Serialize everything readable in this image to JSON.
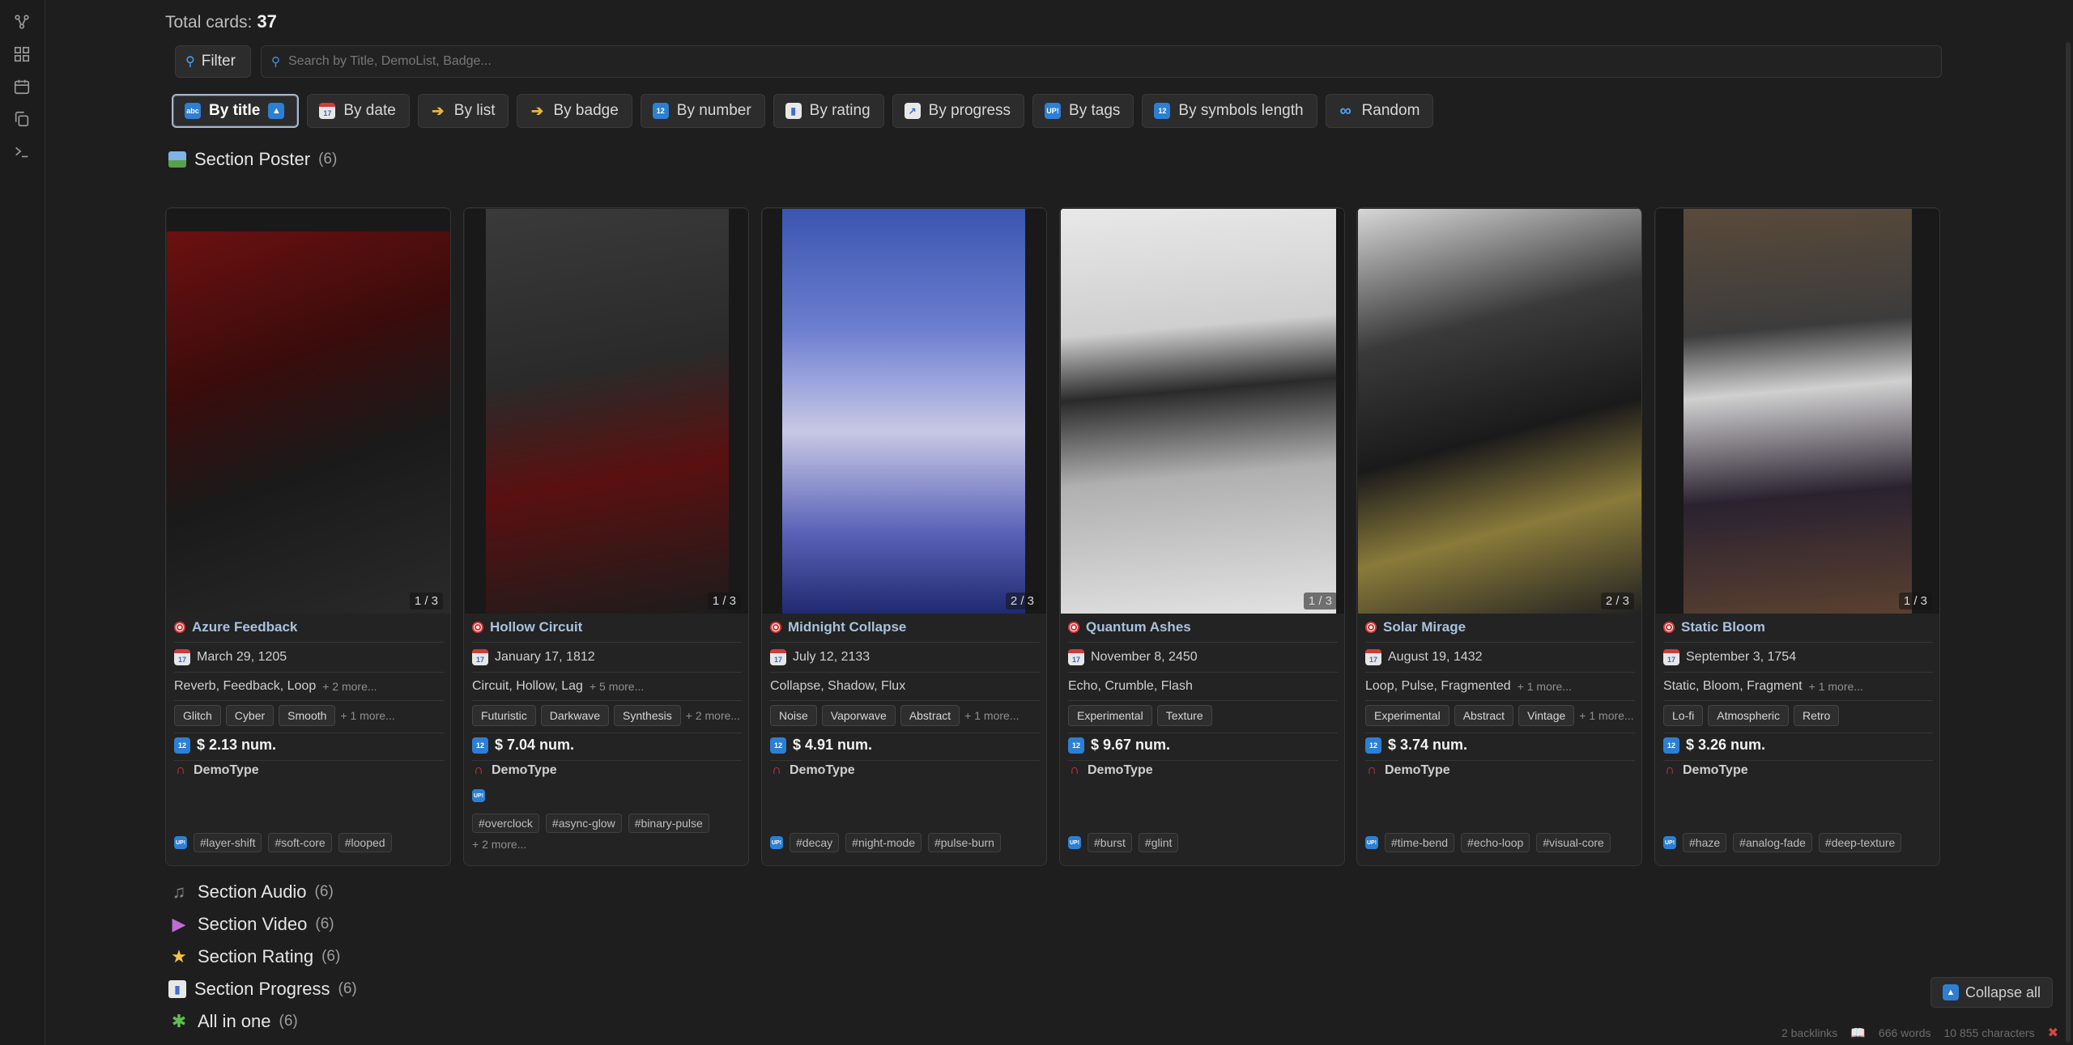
{
  "header": {
    "total_label": "Total cards:",
    "total_value": "37"
  },
  "filter": {
    "button_label": "Filter",
    "search_placeholder": "Search by Title, DemoList, Badge..."
  },
  "sort_buttons": [
    {
      "label": "By title",
      "icon": "abc-icon",
      "active": true
    },
    {
      "label": "By date",
      "icon": "calendar-icon"
    },
    {
      "label": "By list",
      "icon": "tag-icon"
    },
    {
      "label": "By badge",
      "icon": "tag-icon"
    },
    {
      "label": "By number",
      "icon": "numbers-icon"
    },
    {
      "label": "By rating",
      "icon": "bar-chart-icon"
    },
    {
      "label": "By progress",
      "icon": "line-chart-icon"
    },
    {
      "label": "By tags",
      "icon": "up-icon"
    },
    {
      "label": "By symbols length",
      "icon": "numbers-icon"
    },
    {
      "label": "Random",
      "icon": "infinity-icon"
    }
  ],
  "section_poster": {
    "label": "Section Poster",
    "count": "(6)"
  },
  "cards": [
    {
      "title": "Azure Feedback",
      "date": "March 29, 1205",
      "list": "Reverb, Feedback, Loop",
      "list_more": "+ 2 more...",
      "pills": [
        "Glitch",
        "Cyber",
        "Smooth"
      ],
      "pills_more": "+ 1 more...",
      "price": "$ 2.13 num.",
      "badge": "DemoType",
      "pager": "1 / 3",
      "tags": [
        "#layer-shift",
        "#soft-core",
        "#looped"
      ],
      "tags_more": ""
    },
    {
      "title": "Hollow Circuit",
      "date": "January 17, 1812",
      "list": "Circuit, Hollow, Lag",
      "list_more": "+ 5 more...",
      "pills": [
        "Futuristic",
        "Darkwave",
        "Synthesis"
      ],
      "pills_more": "+ 2 more...",
      "price": "$ 7.04 num.",
      "badge": "DemoType",
      "pager": "1 / 3",
      "tags": [
        "#overclock",
        "#async-glow",
        "#binary-pulse"
      ],
      "tags_more": "+ 2 more..."
    },
    {
      "title": "Midnight Collapse",
      "date": "July 12, 2133",
      "list": "Collapse, Shadow, Flux",
      "list_more": "",
      "pills": [
        "Noise",
        "Vaporwave",
        "Abstract"
      ],
      "pills_more": "+ 1 more...",
      "price": "$ 4.91 num.",
      "badge": "DemoType",
      "pager": "2 / 3",
      "tags": [
        "#decay",
        "#night-mode",
        "#pulse-burn"
      ],
      "tags_more": ""
    },
    {
      "title": "Quantum Ashes",
      "date": "November 8, 2450",
      "list": "Echo, Crumble, Flash",
      "list_more": "",
      "pills": [
        "Experimental",
        "Texture"
      ],
      "pills_more": "",
      "price": "$ 9.67 num.",
      "badge": "DemoType",
      "pager": "1 / 3",
      "tags": [
        "#burst",
        "#glint"
      ],
      "tags_more": ""
    },
    {
      "title": "Solar Mirage",
      "date": "August 19, 1432",
      "list": "Loop, Pulse, Fragmented",
      "list_more": "+ 1 more...",
      "pills": [
        "Experimental",
        "Abstract",
        "Vintage"
      ],
      "pills_more": "+ 1 more...",
      "price": "$ 3.74 num.",
      "badge": "DemoType",
      "pager": "2 / 3",
      "tags": [
        "#time-bend",
        "#echo-loop",
        "#visual-core"
      ],
      "tags_more": ""
    },
    {
      "title": "Static Bloom",
      "date": "September 3, 1754",
      "list": "Static, Bloom, Fragment",
      "list_more": "+ 1 more...",
      "pills": [
        "Lo-fi",
        "Atmospheric",
        "Retro"
      ],
      "pills_more": "",
      "price": "$ 3.26 num.",
      "badge": "DemoType",
      "pager": "1 / 3",
      "tags": [
        "#haze",
        "#analog-fade",
        "#deep-texture"
      ],
      "tags_more": ""
    }
  ],
  "sections": [
    {
      "label": "Section Audio",
      "count": "(6)",
      "icon": "music-note-icon"
    },
    {
      "label": "Section Video",
      "count": "(6)",
      "icon": "clapper-icon"
    },
    {
      "label": "Section Rating",
      "count": "(6)",
      "icon": "star-icon"
    },
    {
      "label": "Section Progress",
      "count": "(6)",
      "icon": "bar-chart-icon"
    },
    {
      "label": "All in one",
      "count": "(6)",
      "icon": "puzzle-icon"
    }
  ],
  "collapse_button": "Collapse all",
  "status_bar": {
    "backlinks": "2 backlinks",
    "words": "666 words",
    "characters": "10 855 characters"
  },
  "colors": {
    "accent": "#a9c2dd",
    "background": "#1e1e1e",
    "card": "#232323"
  }
}
